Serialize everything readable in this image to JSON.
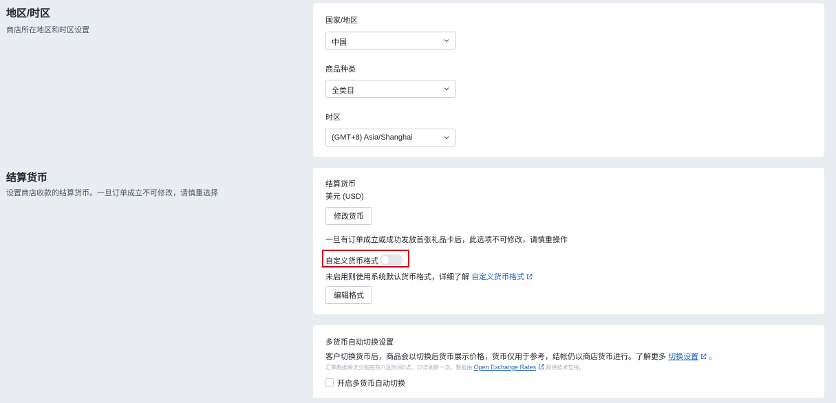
{
  "region": {
    "title": "地区/时区",
    "desc": "商店所在地区和时区设置",
    "country_label": "国家/地区",
    "country_value": "中国",
    "category_label": "商品种类",
    "category_value": "全类目",
    "timezone_label": "时区",
    "timezone_value": "(GMT+8) Asia/Shanghai"
  },
  "currency": {
    "title": "结算货币",
    "desc": "设置商店收款的结算货币。一旦订单成立不可修改，请慎重选择",
    "label": "结算货币",
    "value": "美元 (USD)",
    "change_button": "修改货币",
    "warning": "一旦有订单成立或成功发放首张礼品卡后，此选项不可修改，请慎重操作",
    "custom_format_label": "自定义货币格式",
    "custom_format_enabled": false,
    "custom_format_hint": "未启用则使用系统默认货币格式，详细了解",
    "custom_format_link": "自定义货币格式",
    "edit_format_button": "编辑格式"
  },
  "multi_currency": {
    "title": "多货币自动切换设置",
    "desc_prefix": "客户切换货币后，商品会以切换后货币展示价格，货币仅用于参考，结帐仍以商店货币进行。了解更多",
    "desc_link": "切换设置",
    "desc_suffix": "。",
    "rate_note_prefix": "汇率数据每天分别在东八区时间0点、12点刷新一次。数据由",
    "rate_note_link": "Open Exchange Rates",
    "rate_note_suffix": "提供技术支持。",
    "checkbox_label": "开启多货币自动切换",
    "checkbox_checked": false
  },
  "colors": {
    "background": "#e9ecf1",
    "card": "#ffffff",
    "link": "#2563c7",
    "highlight": "#d0021b"
  }
}
